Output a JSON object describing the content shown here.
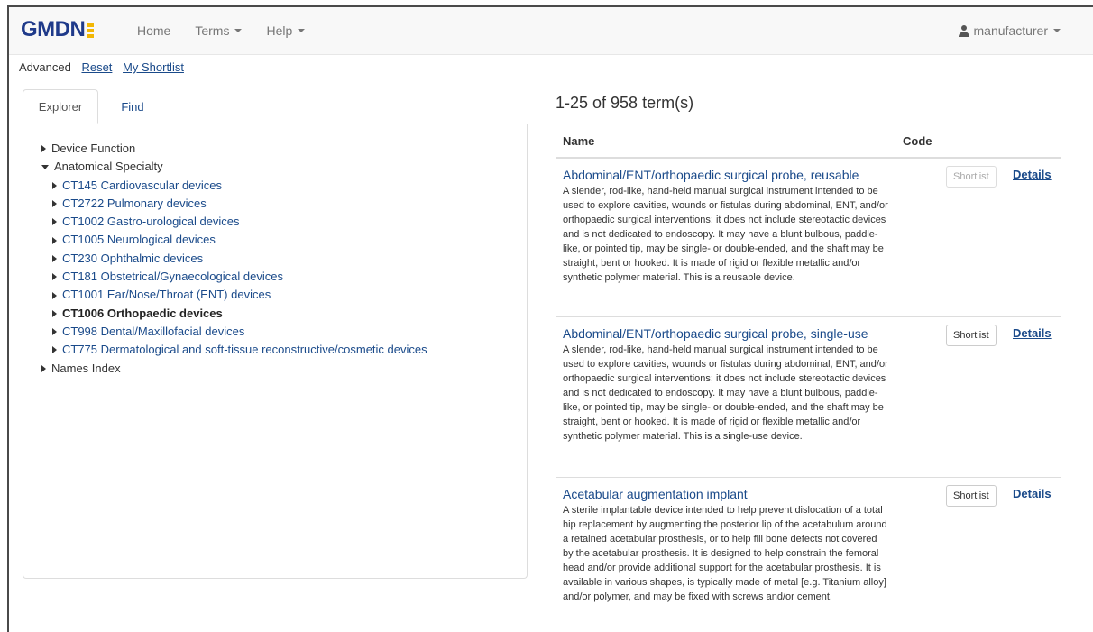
{
  "navbar": {
    "brand": "GMDN",
    "items": [
      {
        "label": "Home"
      },
      {
        "label": "Terms"
      },
      {
        "label": "Help"
      }
    ],
    "user": "manufacturer"
  },
  "links": {
    "advanced": "Advanced",
    "reset": "Reset",
    "shortlist": "My Shortlist"
  },
  "tabs": {
    "explorer": "Explorer",
    "find": "Find"
  },
  "tree": {
    "device_function": "Device Function",
    "anatomical_specialty": "Anatomical Specialty",
    "children": [
      {
        "label": "CT145 Cardiovascular devices"
      },
      {
        "label": "CT2722 Pulmonary devices"
      },
      {
        "label": "CT1002 Gastro-urological devices"
      },
      {
        "label": "CT1005 Neurological devices"
      },
      {
        "label": "CT230 Ophthalmic devices"
      },
      {
        "label": "CT181 Obstetrical/Gynaecological devices"
      },
      {
        "label": "CT1001 Ear/Nose/Throat (ENT) devices"
      },
      {
        "label": "CT1006 Orthopaedic devices"
      },
      {
        "label": "CT998 Dental/Maxillofacial devices"
      },
      {
        "label": "CT775 Dermatological and soft-tissue reconstructive/cosmetic devices"
      }
    ],
    "names_index": "Names Index"
  },
  "results": {
    "count": "1-25 of 958 term(s)",
    "header_name": "Name",
    "header_code": "Code",
    "shortlist_label": "Shortlist",
    "details_label": "Details",
    "rows": [
      {
        "name": "Abdominal/ENT/orthopaedic surgical probe, reusable",
        "desc": "A slender, rod-like, hand-held manual surgical instrument intended to be used to explore cavities, wounds or fistulas during abdominal, ENT, and/or orthopaedic surgical interventions; it does not include stereotactic devices and is not dedicated to endoscopy. It may have a blunt bulbous, paddle-like, or pointed tip, may be single- or double-ended, and the shaft may be straight, bent or hooked. It is made of rigid or flexible metallic and/or synthetic polymer material. This is a reusable device."
      },
      {
        "name": "Abdominal/ENT/orthopaedic surgical probe, single-use",
        "desc": "A slender, rod-like, hand-held manual surgical instrument intended to be used to explore cavities, wounds or fistulas during abdominal, ENT, and/or orthopaedic surgical interventions; it does not include stereotactic devices and is not dedicated to endoscopy. It may have a blunt bulbous, paddle-like, or pointed tip, may be single- or double-ended, and the shaft may be straight, bent or hooked. It is made of rigid or flexible metallic and/or synthetic polymer material. This is a single-use device."
      },
      {
        "name": "Acetabular augmentation implant",
        "desc": "A sterile implantable device intended to help prevent dislocation of a total hip replacement by augmenting the posterior lip of the acetabulum around a retained acetabular prosthesis, or to help fill bone defects not covered by the acetabular prosthesis. It is designed to help constrain the femoral head and/or provide additional support for the acetabular prosthesis. It is available in various shapes, is typically made of metal [e.g. Titanium alloy] and/or polymer, and may be fixed with screws and/or cement."
      }
    ]
  }
}
